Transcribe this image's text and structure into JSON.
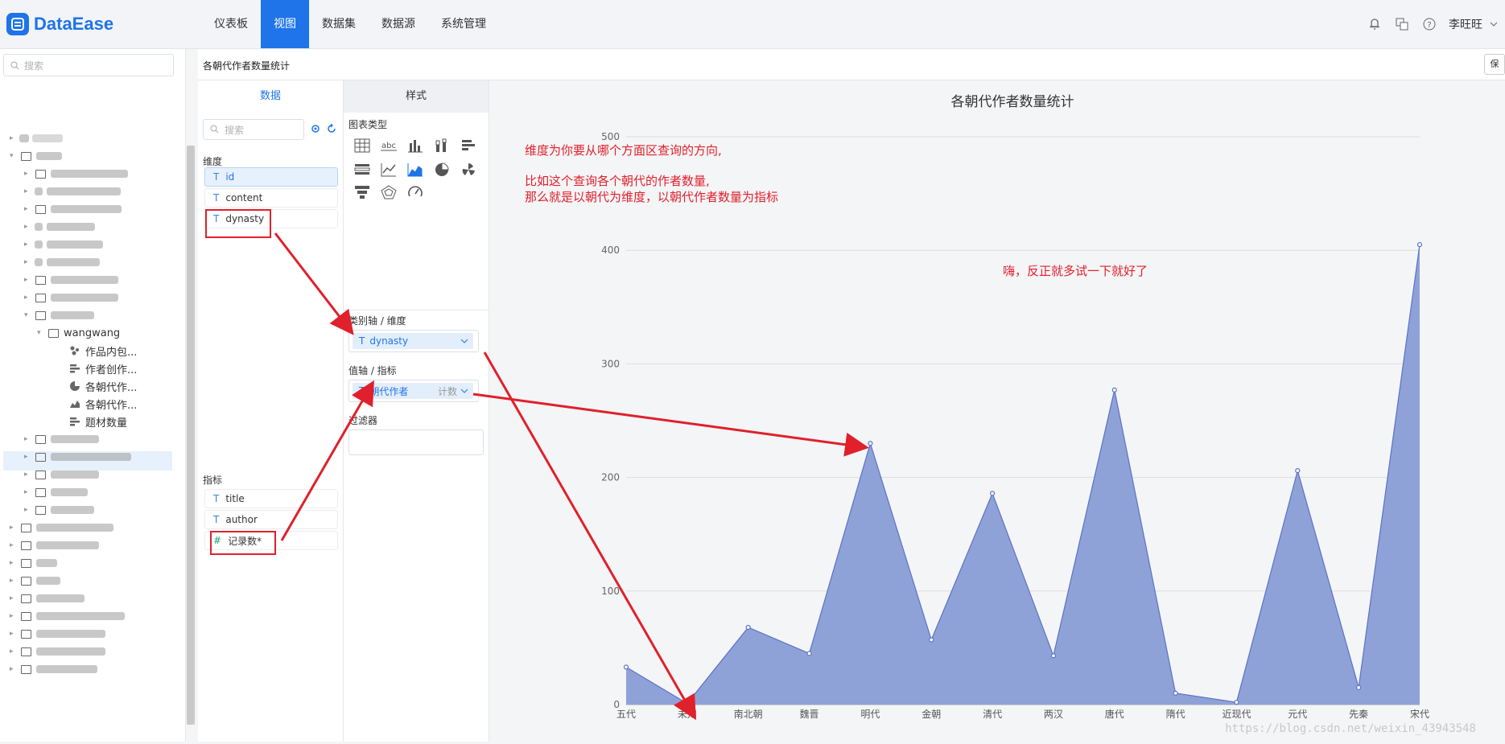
{
  "app": {
    "logo_text": "DataEase",
    "user": "李旺旺"
  },
  "nav": [
    "仪表板",
    "视图",
    "数据集",
    "数据源",
    "系统管理"
  ],
  "nav_active": 1,
  "left_search_placeholder": "搜索",
  "tree_visible": [
    {
      "label": "wangwang"
    },
    {
      "label": "作品内包...",
      "icon": "scatter-icon"
    },
    {
      "label": "作者创作...",
      "icon": "hbar-icon"
    },
    {
      "label": "各朝代作...",
      "icon": "pie-icon"
    },
    {
      "label": "各朝代作...",
      "icon": "area-icon",
      "selected": true
    },
    {
      "label": "题材数量",
      "icon": "hbar-icon"
    }
  ],
  "toolbar": {
    "title": "各朝代作者数量统计",
    "button": "保"
  },
  "data_panel": {
    "tab_data": "数据",
    "tab_style": "样式",
    "search_placeholder": "搜索",
    "dimensions_title": "维度",
    "dimensions": [
      "id",
      "content",
      "dynasty"
    ],
    "measures_title": "指标",
    "measures": [
      {
        "type": "T",
        "name": "title"
      },
      {
        "type": "T",
        "name": "author"
      },
      {
        "type": "#",
        "name": "记录数*"
      }
    ]
  },
  "style_panel": {
    "chart_type_title": "图表类型",
    "category_axis_title": "类别轴 / 维度",
    "category_field": "dynasty",
    "value_axis_title": "值轴 / 指标",
    "value_field": "朝代作者",
    "value_agg": "计数",
    "filter_title": "过滤器"
  },
  "annotations": {
    "line1": "维度为你要从哪个方面区查询的方向,",
    "line2": "比如这个查询各个朝代的作者数量,",
    "line3": "那么就是以朝代为维度，以朝代作者数量为指标",
    "line4": "嗨，反正就多试一下就好了"
  },
  "watermark": "https://blog.csdn.net/weixin_43943548",
  "colors": {
    "accent": "#1e74e8",
    "area_fill": "#8fa2d8",
    "area_line": "#5a72c6",
    "annotation": "#e0202a"
  },
  "chart_data": {
    "type": "area",
    "title": "各朝代作者数量统计",
    "categories": [
      "五代",
      "未知",
      "南北朝",
      "魏晋",
      "明代",
      "金朝",
      "清代",
      "两汉",
      "唐代",
      "隋代",
      "近现代",
      "元代",
      "先秦",
      "宋代"
    ],
    "values": [
      33,
      1,
      68,
      45,
      230,
      57,
      186,
      43,
      277,
      10,
      2,
      206,
      15,
      405
    ],
    "yticks": [
      0,
      100,
      200,
      300,
      400,
      500
    ],
    "ylim": [
      0,
      500
    ],
    "grid": true
  }
}
